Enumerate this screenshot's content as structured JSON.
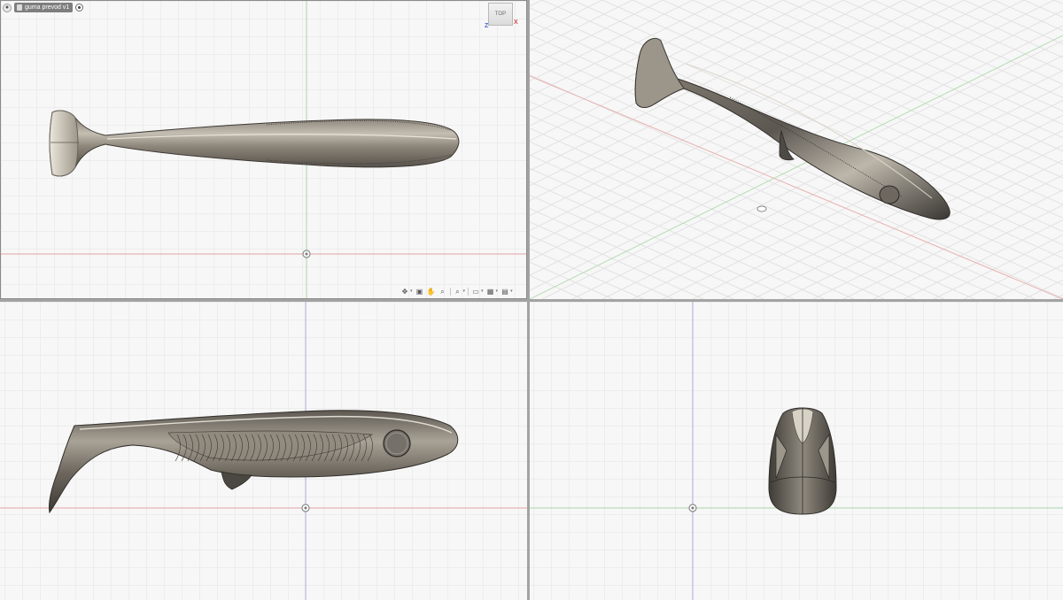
{
  "browser": {
    "document_name": "guma prevod v1",
    "visibility_icon": "eye-icon",
    "document_icon": "document-icon",
    "activate_icon": "radio-target-icon"
  },
  "viewcube": {
    "face_label": "TOP",
    "axis_x": "X",
    "axis_z": "Z"
  },
  "navigation_bar": {
    "tools": [
      {
        "name": "orbit-icon",
        "glyph": "✥",
        "has_menu": true
      },
      {
        "name": "look-at-icon",
        "glyph": "▣",
        "has_menu": false
      },
      {
        "name": "pan-hand-icon",
        "glyph": "✋",
        "has_menu": false
      },
      {
        "name": "zoom-icon",
        "glyph": "⌕",
        "has_menu": false
      },
      {
        "name": "fit-zoom-icon",
        "glyph": "⌕",
        "has_menu": true
      },
      {
        "name": "display-settings-icon",
        "glyph": "▭",
        "has_menu": true
      },
      {
        "name": "grid-settings-icon",
        "glyph": "▦",
        "has_menu": true
      },
      {
        "name": "viewports-icon",
        "glyph": "▤",
        "has_menu": true
      }
    ]
  },
  "viewports": [
    "top",
    "isometric",
    "side",
    "front"
  ],
  "colors": {
    "background": "#f7f7f7",
    "grid_minor": "#e4e4e4",
    "grid_major": "#cfcfcf",
    "axis_red": "#e39c9c",
    "axis_green": "#9fd39f",
    "axis_blue": "#a9a9d9",
    "body_dark": "#4e4a45",
    "body_mid": "#7a746b",
    "body_light": "#c9c3b7",
    "divider": "#a3a3a3"
  }
}
